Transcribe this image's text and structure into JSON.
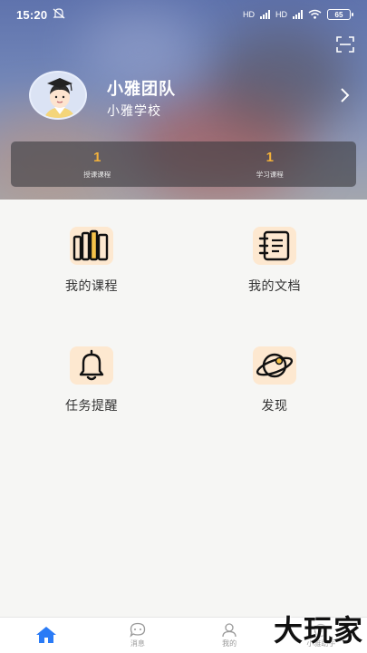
{
  "status_bar": {
    "time": "15:20",
    "network_1": "HD",
    "network_2": "HD",
    "battery": "65"
  },
  "profile": {
    "name": "小雅团队",
    "school": "小雅学校"
  },
  "stats": [
    {
      "value": "1",
      "label": "授课课程"
    },
    {
      "value": "1",
      "label": "学习课程"
    }
  ],
  "features": [
    {
      "label": "我的课程",
      "icon": "books-icon"
    },
    {
      "label": "我的文档",
      "icon": "notebook-icon"
    },
    {
      "label": "任务提醒",
      "icon": "bell-icon"
    },
    {
      "label": "发现",
      "icon": "planet-icon"
    }
  ],
  "tabs": [
    {
      "label": "",
      "icon": "home-icon",
      "active": true
    },
    {
      "label": "消息",
      "icon": "chat-icon",
      "active": false
    },
    {
      "label": "我的",
      "icon": "person-icon",
      "active": false
    },
    {
      "label": "小雅助手",
      "icon": "assistant-icon",
      "active": false
    }
  ],
  "watermark": "大玩家",
  "colors": {
    "accent": "#2a7bf6",
    "stat_number": "#f2b13a",
    "icon_bg": "#fde8d0"
  }
}
